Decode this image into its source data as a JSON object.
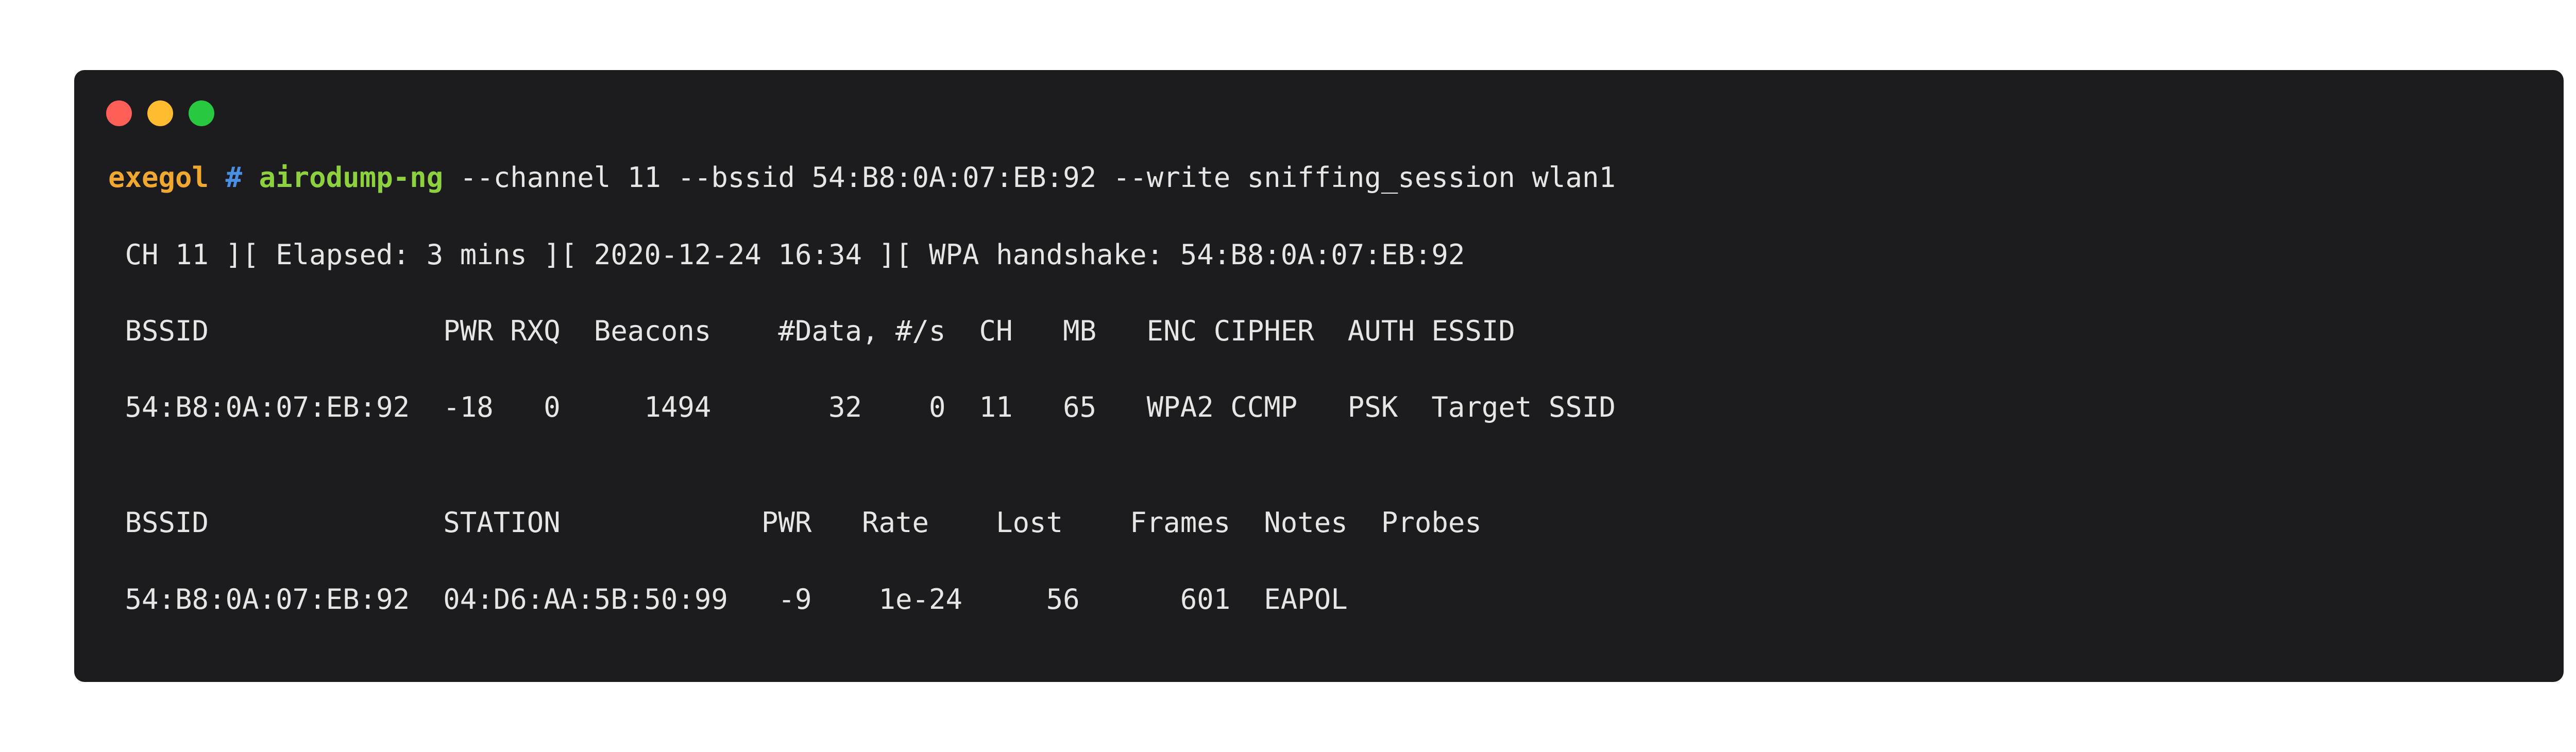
{
  "window": {
    "controls": [
      "close",
      "minimize",
      "maximize"
    ]
  },
  "prompt": {
    "user": "exegol",
    "symbol": "#",
    "command": "airodump-ng",
    "args": " --channel 11 --bssid 54:B8:0A:07:EB:92 --write sniffing_session wlan1"
  },
  "output": {
    "status_line": " CH 11 ][ Elapsed: 3 mins ][ 2020-12-24 16:34 ][ WPA handshake: 54:B8:0A:07:EB:92",
    "ap_header": " BSSID              PWR RXQ  Beacons    #Data, #/s  CH   MB   ENC CIPHER  AUTH ESSID",
    "ap_row": " 54:B8:0A:07:EB:92  -18   0     1494       32    0  11   65   WPA2 CCMP   PSK  Target SSID",
    "station_header": " BSSID              STATION            PWR   Rate    Lost    Frames  Notes  Probes",
    "station_row": " 54:B8:0A:07:EB:92  04:D6:AA:5B:50:99   -9    1e-24     56      601  EAPOL"
  },
  "colors": {
    "background": "#1c1c1e",
    "user": "#f0a830",
    "hash": "#4a90e2",
    "command": "#8dd13f",
    "text": "#e6e6e6"
  }
}
